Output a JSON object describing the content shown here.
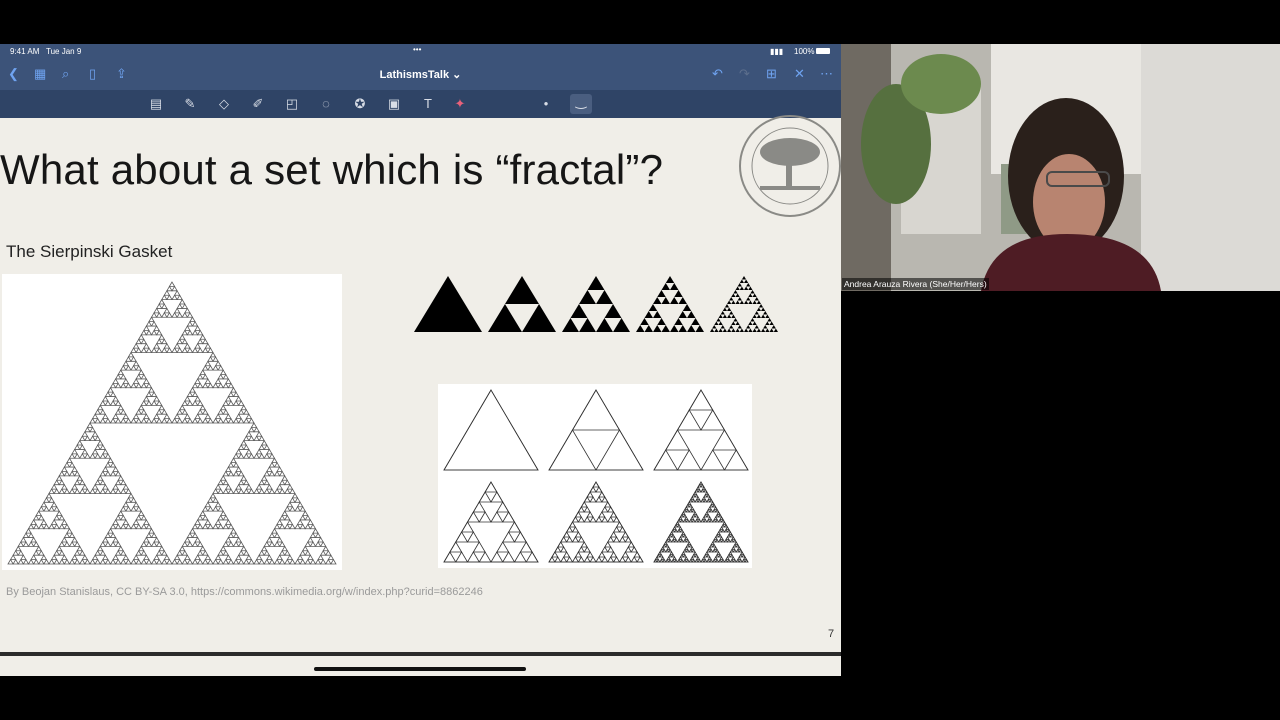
{
  "status": {
    "time": "9:41 AM",
    "date": "Tue Jan 9",
    "dots": "•••",
    "battery": "100%"
  },
  "nav": {
    "doc_title": "LathismsTalk ⌄"
  },
  "icons": {
    "nav": [
      "back-icon",
      "grid-icon",
      "search-icon",
      "bookmark-icon",
      "share-icon",
      "undo-icon",
      "redo-icon",
      "add-page-icon",
      "close-icon",
      "more-icon"
    ],
    "tools": [
      "page-tool-icon",
      "pen-icon",
      "eraser-icon",
      "highlighter-icon",
      "shapes-icon",
      "lasso-icon",
      "star-icon",
      "image-icon",
      "text-icon",
      "laser-pointer-icon"
    ]
  },
  "slide": {
    "title": "What about a set which is “fractal”?",
    "subtitle": "The Sierpinski Gasket",
    "credit": "By Beojan Stanislaus, CC BY-SA 3.0, https://commons.wikimedia.org/w/index.php?curid=8862246",
    "page_number": "7"
  },
  "video": {
    "speaker_name": "Andrea Arauza Rivera (She/Her/Hers)"
  },
  "colors": {
    "navbar": "#3c5379",
    "toolbar": "#2f4466",
    "slide_bg": "#f0eee8"
  }
}
